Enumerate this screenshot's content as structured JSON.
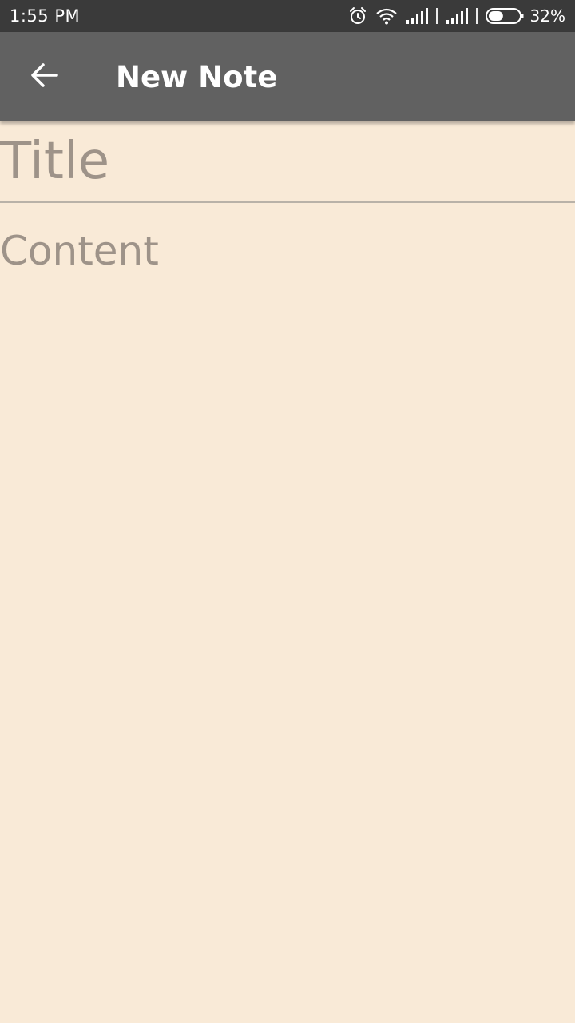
{
  "status_bar": {
    "time": "1:55 PM",
    "battery_percent": "32%",
    "battery_level": 0.32,
    "icons": [
      "alarm-icon",
      "wifi-icon",
      "signal-icon",
      "signal-icon",
      "battery-icon"
    ]
  },
  "app_bar": {
    "title": "New Note",
    "back_icon": "arrow-left-icon",
    "background": "#616161"
  },
  "editor": {
    "title_placeholder": "Title",
    "title_value": "",
    "content_placeholder": "Content",
    "content_value": "",
    "background": "#f9ead7"
  }
}
